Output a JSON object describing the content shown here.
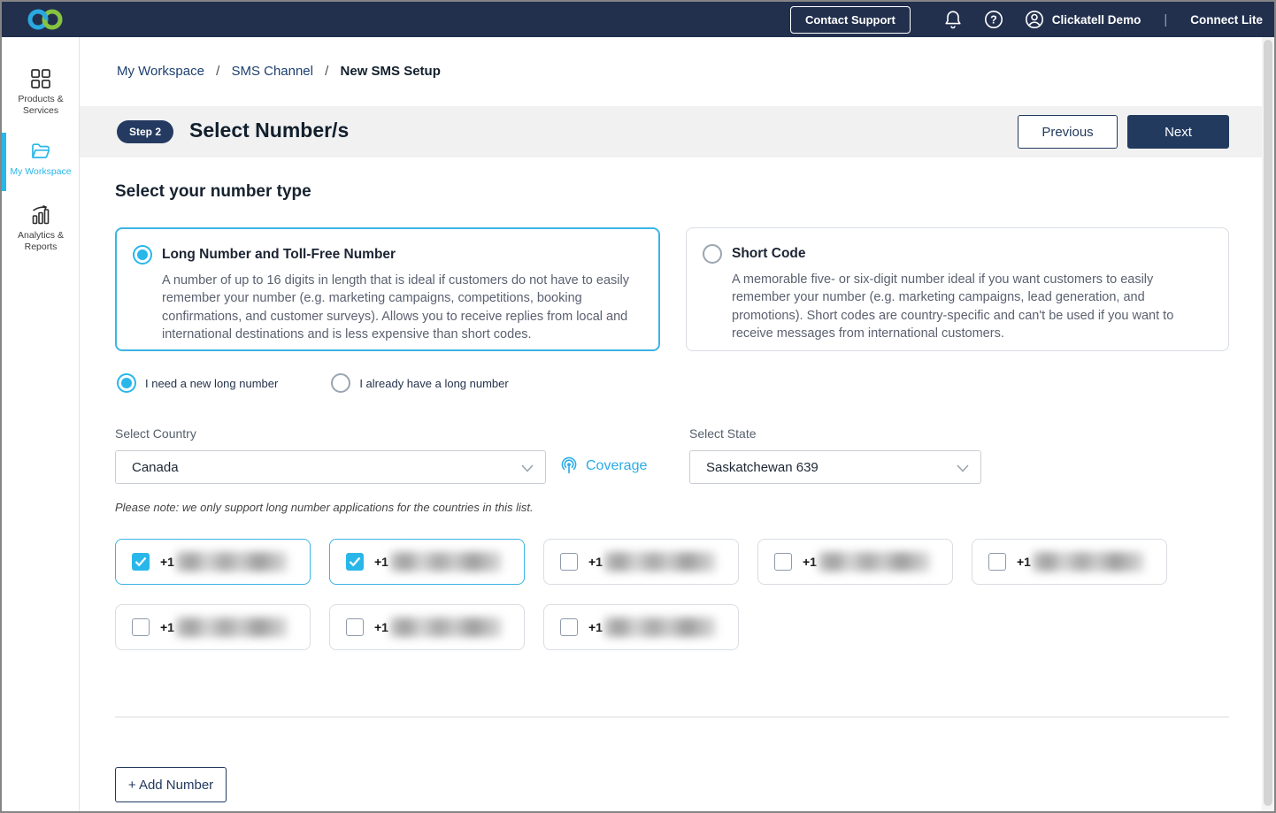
{
  "header": {
    "contact_support_label": "Contact Support",
    "user_name": "Clickatell Demo",
    "separator": "|",
    "product_name": "Connect Lite",
    "icons": {
      "logo": "clickatell-interlocked-rings",
      "bell": "notifications-bell",
      "help": "question-mark-circle",
      "user": "person-circle"
    }
  },
  "sidebar": {
    "items": [
      {
        "label": "Products & Services",
        "icon": "grid-icon",
        "active": false
      },
      {
        "label": "My Workspace",
        "icon": "folder-icon",
        "active": true
      },
      {
        "label": "Analytics & Reports",
        "icon": "bar-chart-icon",
        "active": false
      }
    ]
  },
  "breadcrumb": {
    "separator": "/",
    "items": [
      "My Workspace",
      "SMS Channel",
      "New SMS Setup"
    ]
  },
  "step_header": {
    "badge": "Step 2",
    "title": "Select Number/s",
    "previous_label": "Previous",
    "next_label": "Next"
  },
  "main": {
    "section_title": "Select your number type",
    "number_types": [
      {
        "title": "Long Number and Toll-Free Number",
        "description": "A number of up to 16 digits in length that is ideal if customers do not have to easily remember your number (e.g. marketing campaigns, competitions, booking confirmations, and customer surveys). Allows you to receive replies from local and international destinations and is less expensive than short codes.",
        "selected": true
      },
      {
        "title": "Short Code",
        "description": "A memorable five- or six-digit number ideal if you want customers to easily remember your number (e.g. marketing campaigns, lead generation, and promotions). Short codes are country-specific and can't be used if you want to receive messages from international customers.",
        "selected": false
      }
    ],
    "long_number_options": [
      {
        "label": "I need a new long number",
        "selected": true
      },
      {
        "label": "I already have a long number",
        "selected": false
      }
    ],
    "country": {
      "label": "Select Country",
      "value": "Canada"
    },
    "coverage_label": "Coverage",
    "state": {
      "label": "Select State",
      "value": "Saskatchewan 639"
    },
    "note": "Please note: we only support long number applications for the countries in this list.",
    "numbers": [
      {
        "prefix": "+1",
        "checked": true,
        "number_redacted": true
      },
      {
        "prefix": "+1",
        "checked": true,
        "number_redacted": true
      },
      {
        "prefix": "+1",
        "checked": false,
        "number_redacted": true
      },
      {
        "prefix": "+1",
        "checked": false,
        "number_redacted": true
      },
      {
        "prefix": "+1",
        "checked": false,
        "number_redacted": true
      },
      {
        "prefix": "+1",
        "checked": false,
        "number_redacted": true
      },
      {
        "prefix": "+1",
        "checked": false,
        "number_redacted": true
      },
      {
        "prefix": "+1",
        "checked": false,
        "number_redacted": true
      }
    ],
    "add_number_label": "+ Add Number"
  },
  "colors": {
    "accent_cyan": "#29b7ea",
    "navy_header": "#22304e",
    "navy_button": "#223a5e",
    "card_border_selected": "#3cb4e5",
    "card_border_default": "#d9dde2",
    "logo_blue": "#2aa9e0",
    "logo_green": "#86c440",
    "strip_background": "#f1f1f2"
  }
}
